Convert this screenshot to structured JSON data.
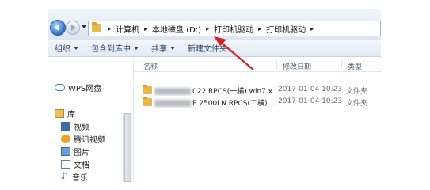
{
  "address_bar": {
    "breadcrumbs": [
      "计算机",
      "本地磁盘 (D:)",
      "打印机驱动",
      "打印机驱动"
    ]
  },
  "toolbar": {
    "organize_label": "组织",
    "include_in_library_label": "包含到库中",
    "share_label": "共享",
    "new_folder_label": "新建文件夹"
  },
  "navigation": {
    "wps_label": "WPS网盘",
    "library_label": "库",
    "items": [
      {
        "label": "视频",
        "icon": "video-icon"
      },
      {
        "label": "腾讯视频",
        "icon": "tencent-video-icon"
      },
      {
        "label": "图片",
        "icon": "pictures-icon"
      },
      {
        "label": "文档",
        "icon": "documents-icon"
      },
      {
        "label": "音乐",
        "icon": "music-icon"
      }
    ]
  },
  "columns": {
    "name": "名称",
    "date_modified": "修改日期",
    "type": "类型"
  },
  "files": [
    {
      "name_visible": "022 RPCS(一横) win7 x...",
      "date": "2017-01-04  10:23",
      "type": "文件夹"
    },
    {
      "name_visible": "P 2500LN RPCS(二横) ...",
      "date": "2017-01-04  10:23",
      "type": "文件夹"
    }
  ],
  "colors": {
    "annotation_arrow": "#d42020",
    "folder": "#e8b84a"
  }
}
